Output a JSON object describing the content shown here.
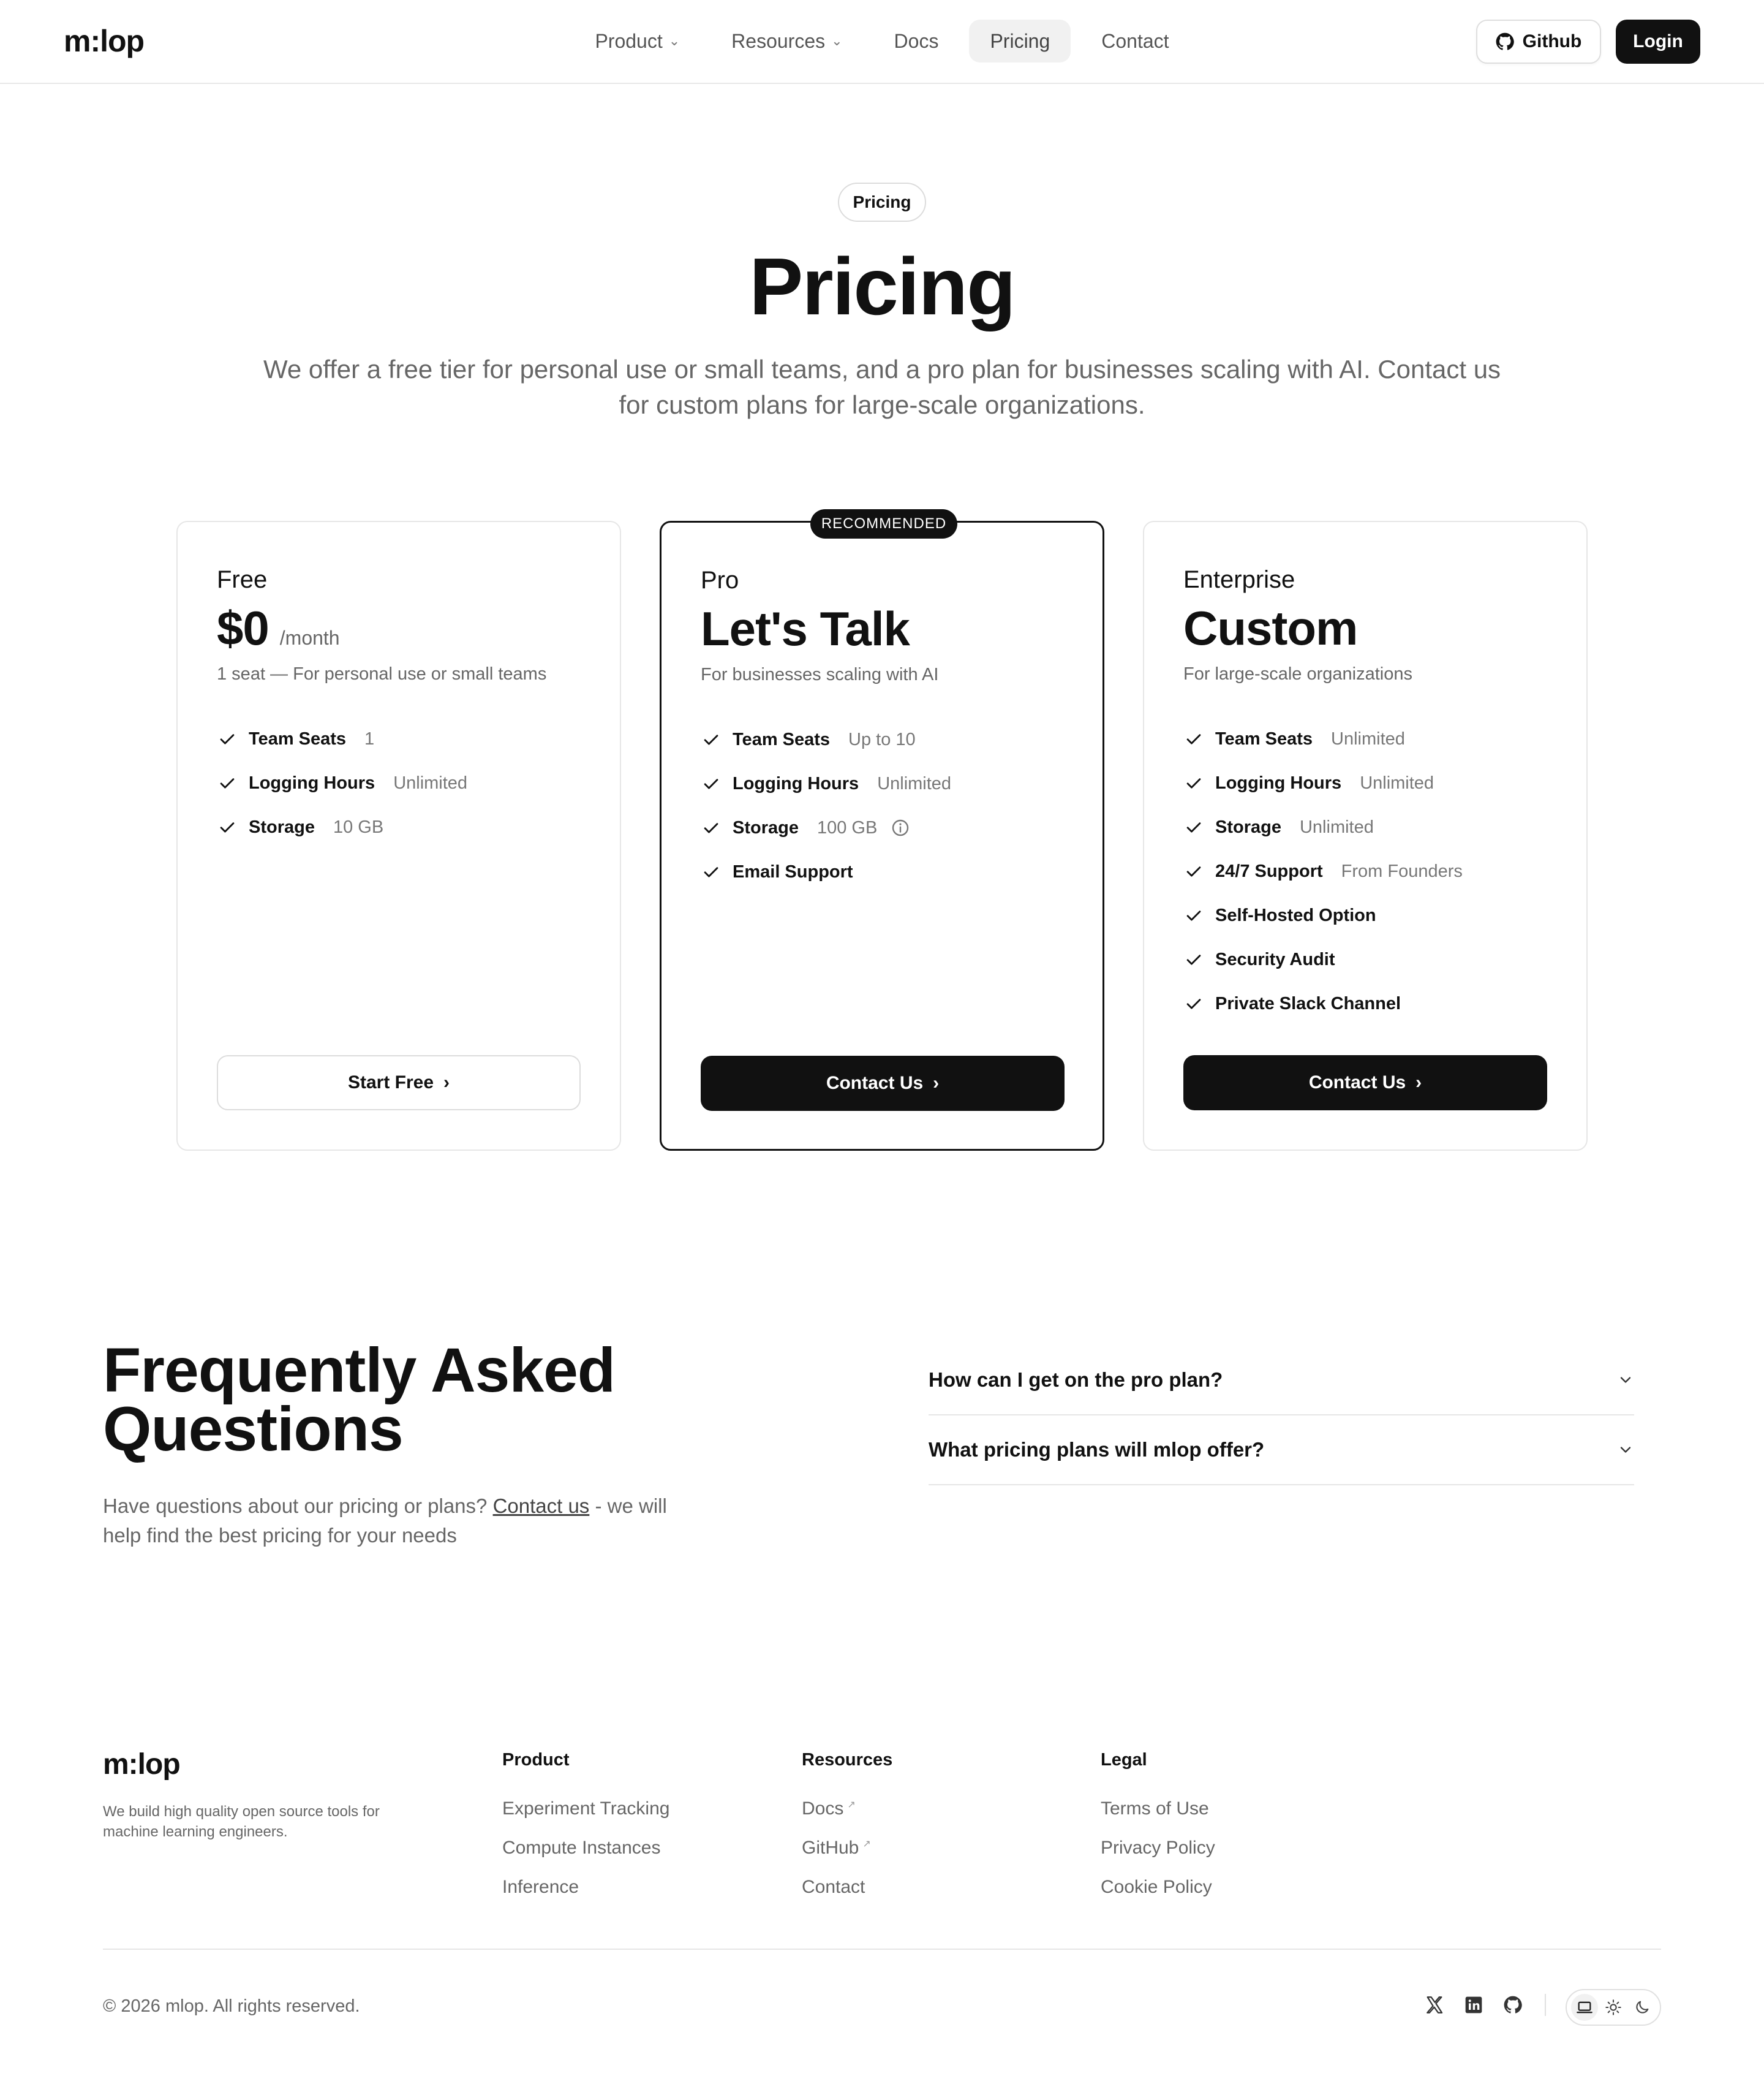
{
  "header": {
    "logo": "m:lop",
    "nav": [
      {
        "label": "Product",
        "dropdown": true
      },
      {
        "label": "Resources",
        "dropdown": true
      },
      {
        "label": "Docs",
        "dropdown": false
      },
      {
        "label": "Pricing",
        "dropdown": false,
        "active": true
      },
      {
        "label": "Contact",
        "dropdown": false
      }
    ],
    "github_label": "Github",
    "login_label": "Login"
  },
  "hero": {
    "pill": "Pricing",
    "title": "Pricing",
    "subtitle": "We offer a free tier for personal use or small teams, and a pro plan for businesses scaling with AI. Contact us for custom plans for large-scale organizations."
  },
  "plans": {
    "free": {
      "name": "Free",
      "price": "$0",
      "unit": "/month",
      "desc": "1 seat — For personal use or small teams",
      "features": [
        {
          "label": "Team Seats",
          "value": "1"
        },
        {
          "label": "Logging Hours",
          "value": "Unlimited"
        },
        {
          "label": "Storage",
          "value": "10 GB"
        }
      ],
      "cta": "Start Free"
    },
    "pro": {
      "badge": "RECOMMENDED",
      "name": "Pro",
      "price": "Let's Talk",
      "desc": "For businesses scaling with AI",
      "features": [
        {
          "label": "Team Seats",
          "value": "Up to 10"
        },
        {
          "label": "Logging Hours",
          "value": "Unlimited"
        },
        {
          "label": "Storage",
          "value": "100 GB"
        },
        {
          "label": "Email Support",
          "value": ""
        }
      ],
      "cta": "Contact Us"
    },
    "enterprise": {
      "name": "Enterprise",
      "price": "Custom",
      "desc": "For large-scale organizations",
      "features": [
        {
          "label": "Team Seats",
          "value": "Unlimited"
        },
        {
          "label": "Logging Hours",
          "value": "Unlimited"
        },
        {
          "label": "Storage",
          "value": "Unlimited"
        },
        {
          "label": "24/7 Support",
          "value": "From Founders"
        },
        {
          "label": "Self-Hosted Option",
          "value": ""
        },
        {
          "label": "Security Audit",
          "value": ""
        },
        {
          "label": "Private Slack Channel",
          "value": ""
        }
      ],
      "cta": "Contact Us"
    }
  },
  "faq": {
    "title": "Frequently Asked Questions",
    "subtitle_before": "Have questions about our pricing or plans? ",
    "subtitle_link": "Contact us",
    "subtitle_after": " - we will help find the best pricing for your needs",
    "questions": [
      "How can I get on the pro plan?",
      "What pricing plans will mlop offer?"
    ]
  },
  "footer": {
    "logo": "m:lop",
    "tagline": "We build high quality open source tools for machine learning engineers.",
    "columns": {
      "product": {
        "title": "Product",
        "links": [
          "Experiment Tracking",
          "Compute Instances",
          "Inference"
        ]
      },
      "resources": {
        "title": "Resources",
        "links": [
          "Docs",
          "GitHub",
          "Contact"
        ]
      },
      "legal": {
        "title": "Legal",
        "links": [
          "Terms of Use",
          "Privacy Policy",
          "Cookie Policy"
        ]
      }
    },
    "copyright": "© 2026 mlop. All rights reserved.",
    "socials": [
      "x-icon",
      "linkedin-icon",
      "github-icon"
    ],
    "theme_options": [
      "laptop-icon",
      "sun-icon",
      "moon-icon"
    ]
  },
  "colors": {
    "text": "#111111",
    "muted": "#666666",
    "border": "#e6e6e6",
    "accent": "#111111",
    "background": "#ffffff"
  }
}
